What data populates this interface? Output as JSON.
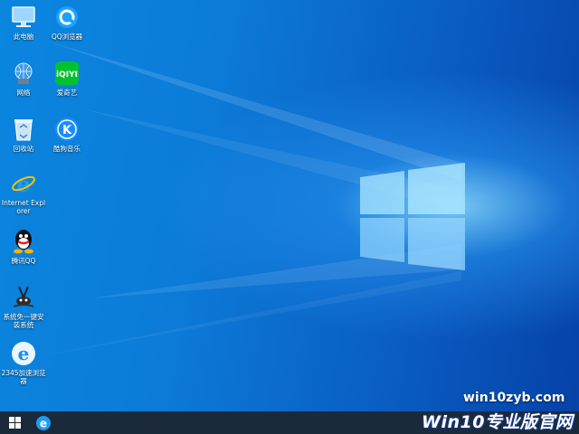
{
  "desktop": {
    "icons": [
      {
        "label": "此电脑",
        "icon": "computer-icon"
      },
      {
        "label": "QQ浏览器",
        "icon": "qq-browser-icon"
      },
      {
        "label": "网络",
        "icon": "network-icon"
      },
      {
        "label": "爱奇艺",
        "icon": "iqiyi-icon"
      },
      {
        "label": "回收站",
        "icon": "recycle-bin-icon"
      },
      {
        "label": "酷狗音乐",
        "icon": "kugou-icon"
      },
      {
        "label": "Internet Explorer",
        "icon": "ie-icon"
      },
      {
        "label": "腾讯QQ",
        "icon": "qq-icon"
      },
      {
        "label": "系统免一键安装系统",
        "icon": "installer-icon"
      },
      {
        "label": "2345加速浏览器",
        "icon": "2345-browser-icon"
      }
    ],
    "watermark_url": "win10zyb.com",
    "watermark_logo": "Win10专业版官网"
  },
  "taskbar": {
    "start_icon": "windows-start-icon",
    "pinned": [
      {
        "icon": "ie-icon"
      }
    ]
  },
  "colors": {
    "taskbar": "#1b2a3a",
    "desktop_base": "#0a86df",
    "desktop_dark": "#0642a8"
  }
}
